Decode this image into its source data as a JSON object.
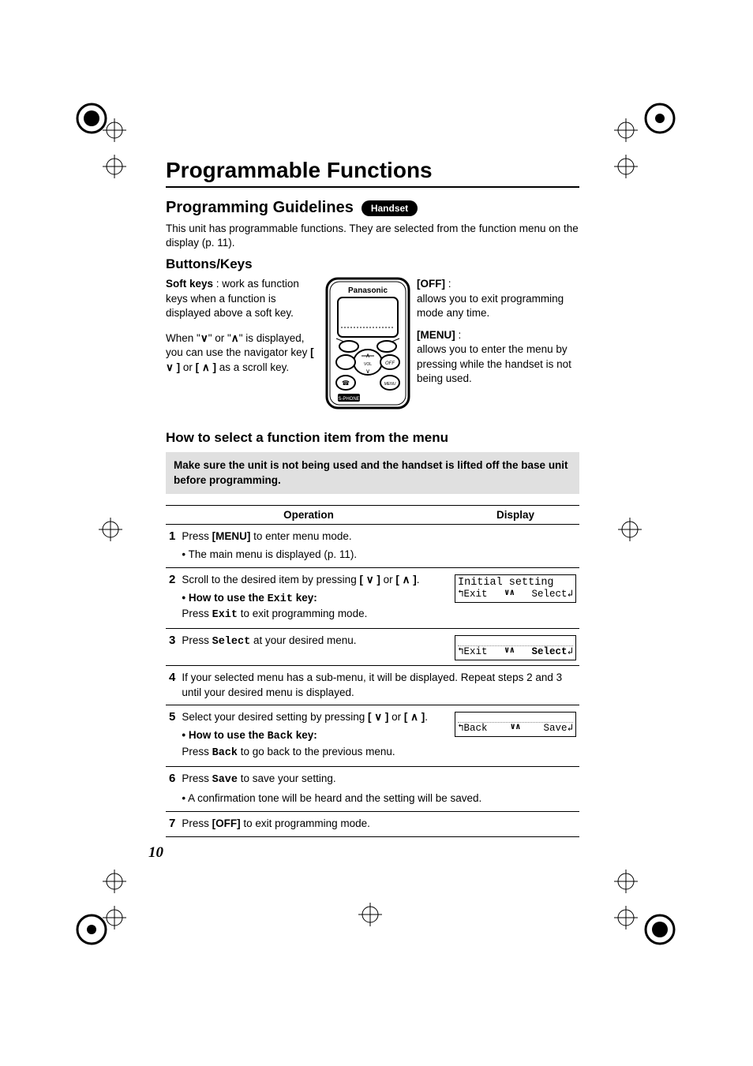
{
  "h1": "Programmable Functions",
  "h2": "Programming Guidelines",
  "pill": "Handset",
  "intro": "This unit has programmable functions. They are selected from the function menu on the display (p. 11).",
  "h3": "Buttons/Keys",
  "left": {
    "soft_label": "Soft keys",
    "soft_text": " : work as function keys when a function is displayed above a soft key.",
    "nav_a": "When \"",
    "nav_b": "\" or \"",
    "nav_c": "\" is displayed, you can use the navigator key ",
    "nav_d": " or ",
    "nav_e": " as a scroll key."
  },
  "right": {
    "off_label": "[OFF]",
    "off_text": "allows you to exit programming mode any time.",
    "menu_label": "[MENU]",
    "menu_text": "allows you to enter the menu by pressing while the handset is not being used."
  },
  "howto_title": "How to select a function item from the menu",
  "greybox": "Make sure the unit is not being used and the handset is lifted off the base unit before programming.",
  "thead": {
    "op": "Operation",
    "disp": "Display"
  },
  "steps": {
    "s1": {
      "a": "Press ",
      "b": "[MENU]",
      "c": " to enter menu mode.",
      "sub": "• The main menu is displayed (p. 11)."
    },
    "s2": {
      "a": "Scroll to the desired item by pressing ",
      "b": " or ",
      "sub1": "• How to use the ",
      "sub1k": "Exit",
      "sub1b": " key:",
      "sub2a": "Press ",
      "sub2k": "Exit",
      "sub2b": " to exit programming mode.",
      "disp_title": "Initial setting",
      "disp_l": "Exit",
      "disp_r": "Select"
    },
    "s3": {
      "a": "Press ",
      "k": "Select",
      "b": " at your desired menu.",
      "disp_l": "Exit",
      "disp_r": "Select"
    },
    "s4": {
      "a": "If your selected menu has a sub-menu, it will be displayed. Repeat steps 2 and 3 until your desired menu is displayed."
    },
    "s5": {
      "a": "Select your desired setting by pressing ",
      "b": " or ",
      "sub1": "• How to use the ",
      "sub1k": "Back",
      "sub1b": " key:",
      "sub2a": "Press ",
      "sub2k": "Back",
      "sub2b": " to go back to the previous menu.",
      "disp_l": "Back",
      "disp_r": "Save"
    },
    "s6": {
      "a": "Press ",
      "k": "Save",
      "b": " to save your setting.",
      "sub": "• A confirmation tone will be heard and the setting will be saved."
    },
    "s7": {
      "a": "Press ",
      "b": "[OFF]",
      "c": " to exit programming mode."
    }
  },
  "arrows": {
    "down": "∨",
    "up": "∧",
    "vv": "∨∧",
    "hookL": "↰",
    "hookR": "↲"
  },
  "keybr": {
    "open": "[ ",
    "close": " ]"
  },
  "page_number": "10",
  "handset_brand": "Panasonic"
}
